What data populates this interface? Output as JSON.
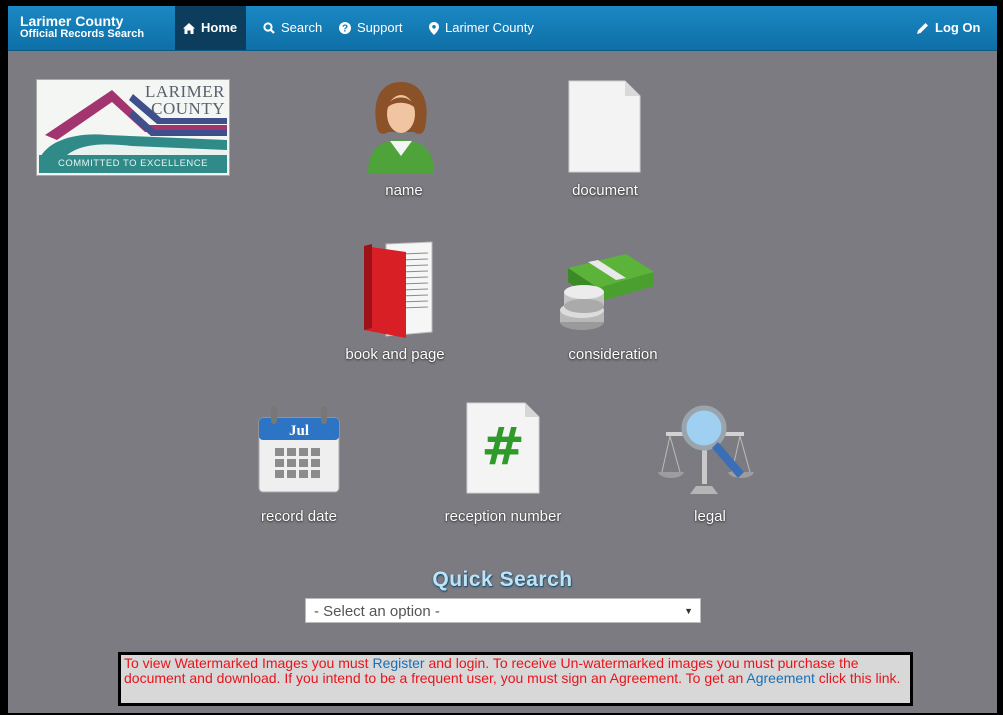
{
  "navbar": {
    "brand_line1": "Larimer County",
    "brand_line2": "Official Records Search",
    "items": [
      {
        "label": "Home",
        "icon": "home-icon",
        "active": true
      },
      {
        "label": "Search",
        "icon": "search-icon",
        "active": false
      },
      {
        "label": "Support",
        "icon": "question-icon",
        "active": false
      },
      {
        "label": "Larimer County",
        "icon": "map-marker-icon",
        "active": false
      }
    ],
    "logon_label": "Log On"
  },
  "logo": {
    "line1": "LARIMER",
    "line2": "COUNTY",
    "tagline": "COMMITTED TO EXCELLENCE"
  },
  "tiles": {
    "name": "name",
    "document": "document",
    "book_and_page": "book and page",
    "consideration": "consideration",
    "record_date": "record date",
    "reception_number": "reception number",
    "legal": "legal",
    "calendar_month": "Jul",
    "hash_symbol": "#"
  },
  "quick_search": {
    "title": "Quick Search",
    "selected": "- Select an option -"
  },
  "notice": {
    "t1": "To view Watermarked Images you must ",
    "link_register": "Register",
    "t2": " and login. To receive Un-watermarked images you must purchase the document and download. If you intend to be a frequent user, you must sign an Agreement. To get an ",
    "link_agreement": "Agreement",
    "t3": " click this link."
  },
  "colors": {
    "navbar": "#1a88c4",
    "active_nav": "#0d3d5c",
    "page_background": "#7c7b81",
    "notice_text": "#e8141c",
    "link": "#1a6fb5",
    "quick_search_title": "#bfe3f6"
  }
}
